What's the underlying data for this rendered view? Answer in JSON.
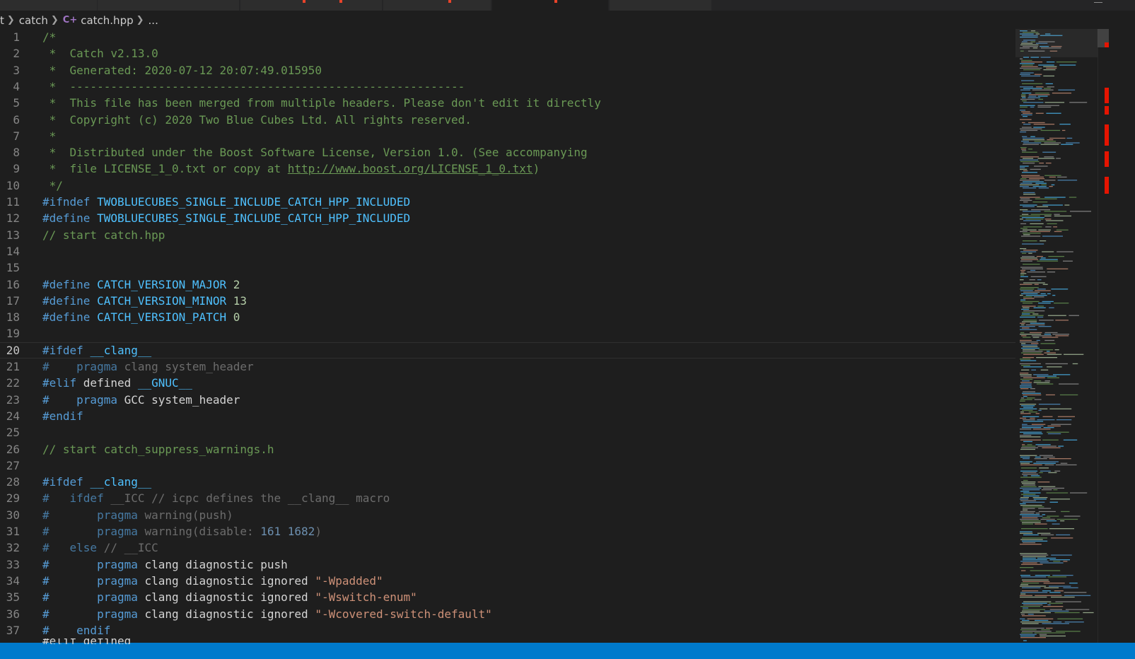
{
  "colors": {
    "accent": "#007acc",
    "error_marker": "#e51400",
    "editor_bg": "#1e1e1e"
  },
  "breadcrumb": {
    "folder_fragment": "t",
    "folder": "catch",
    "file_icon": "cpp-file-icon",
    "file": "catch.hpp",
    "ellipsis": "..."
  },
  "editor": {
    "current_line": 20,
    "lines": [
      [
        [
          "c",
          "/*"
        ]
      ],
      [
        [
          "c",
          " *  Catch v2.13.0"
        ]
      ],
      [
        [
          "c",
          " *  Generated: 2020-07-12 20:07:49.015950"
        ]
      ],
      [
        [
          "c",
          " *  ----------------------------------------------------------"
        ]
      ],
      [
        [
          "c",
          " *  This file has been merged from multiple headers. Please don't edit it directly"
        ]
      ],
      [
        [
          "c",
          " *  Copyright (c) 2020 Two Blue Cubes Ltd. All rights reserved."
        ]
      ],
      [
        [
          "c",
          " *"
        ]
      ],
      [
        [
          "c",
          " *  Distributed under the Boost Software License, Version 1.0. (See accompanying"
        ]
      ],
      [
        [
          "c",
          " *  file LICENSE_1_0.txt or copy at "
        ],
        [
          "l",
          "http://www.boost.org/LICENSE_1_0.txt"
        ],
        [
          "c",
          ")"
        ]
      ],
      [
        [
          "c",
          " */"
        ]
      ],
      [
        [
          "d",
          "#ifndef "
        ],
        [
          "m",
          "TWOBLUECUBES_SINGLE_INCLUDE_CATCH_HPP_INCLUDED"
        ]
      ],
      [
        [
          "d",
          "#define "
        ],
        [
          "m",
          "TWOBLUECUBES_SINGLE_INCLUDE_CATCH_HPP_INCLUDED"
        ]
      ],
      [
        [
          "c",
          "// start catch.hpp"
        ]
      ],
      [],
      [],
      [
        [
          "d",
          "#define "
        ],
        [
          "m",
          "CATCH_VERSION_MAJOR"
        ],
        [
          "p",
          " "
        ],
        [
          "n",
          "2"
        ]
      ],
      [
        [
          "d",
          "#define "
        ],
        [
          "m",
          "CATCH_VERSION_MINOR"
        ],
        [
          "p",
          " "
        ],
        [
          "n",
          "13"
        ]
      ],
      [
        [
          "d",
          "#define "
        ],
        [
          "m",
          "CATCH_VERSION_PATCH"
        ],
        [
          "p",
          " "
        ],
        [
          "n",
          "0"
        ]
      ],
      [],
      [
        [
          "d",
          "#ifdef "
        ],
        [
          "m",
          "__clang__"
        ]
      ],
      [
        [
          "id",
          "#    pragma"
        ],
        [
          "i",
          " clang system_header"
        ]
      ],
      [
        [
          "d",
          "#elif "
        ],
        [
          "p",
          "defined "
        ],
        [
          "m",
          "__GNUC__"
        ]
      ],
      [
        [
          "d",
          "#    pragma"
        ],
        [
          "p",
          " GCC system_header"
        ]
      ],
      [
        [
          "d",
          "#endif"
        ]
      ],
      [],
      [
        [
          "c",
          "// start catch_suppress_warnings.h"
        ]
      ],
      [],
      [
        [
          "d",
          "#ifdef "
        ],
        [
          "m",
          "__clang__"
        ]
      ],
      [
        [
          "id",
          "#   ifdef"
        ],
        [
          "i",
          " __ICC // icpc defines the __clang__ macro"
        ]
      ],
      [
        [
          "id",
          "#       pragma"
        ],
        [
          "i",
          " warning(push)"
        ]
      ],
      [
        [
          "id",
          "#       pragma"
        ],
        [
          "i",
          " warning(disable: "
        ],
        [
          "in",
          "161 1682"
        ],
        [
          "i",
          ")"
        ]
      ],
      [
        [
          "id",
          "#   else"
        ],
        [
          "i",
          " // __ICC"
        ]
      ],
      [
        [
          "d",
          "#       pragma"
        ],
        [
          "p",
          " clang diagnostic push"
        ]
      ],
      [
        [
          "d",
          "#       pragma"
        ],
        [
          "p",
          " clang diagnostic ignored "
        ],
        [
          "s",
          "\"-Wpadded\""
        ]
      ],
      [
        [
          "d",
          "#       pragma"
        ],
        [
          "p",
          " clang diagnostic ignored "
        ],
        [
          "s",
          "\"-Wswitch-enum\""
        ]
      ],
      [
        [
          "d",
          "#       pragma"
        ],
        [
          "p",
          " clang diagnostic ignored "
        ],
        [
          "s",
          "\"-Wcovered-switch-default\""
        ]
      ],
      [
        [
          "d",
          "#    endif"
        ]
      ]
    ],
    "next_line_peek": "#elif defined"
  }
}
